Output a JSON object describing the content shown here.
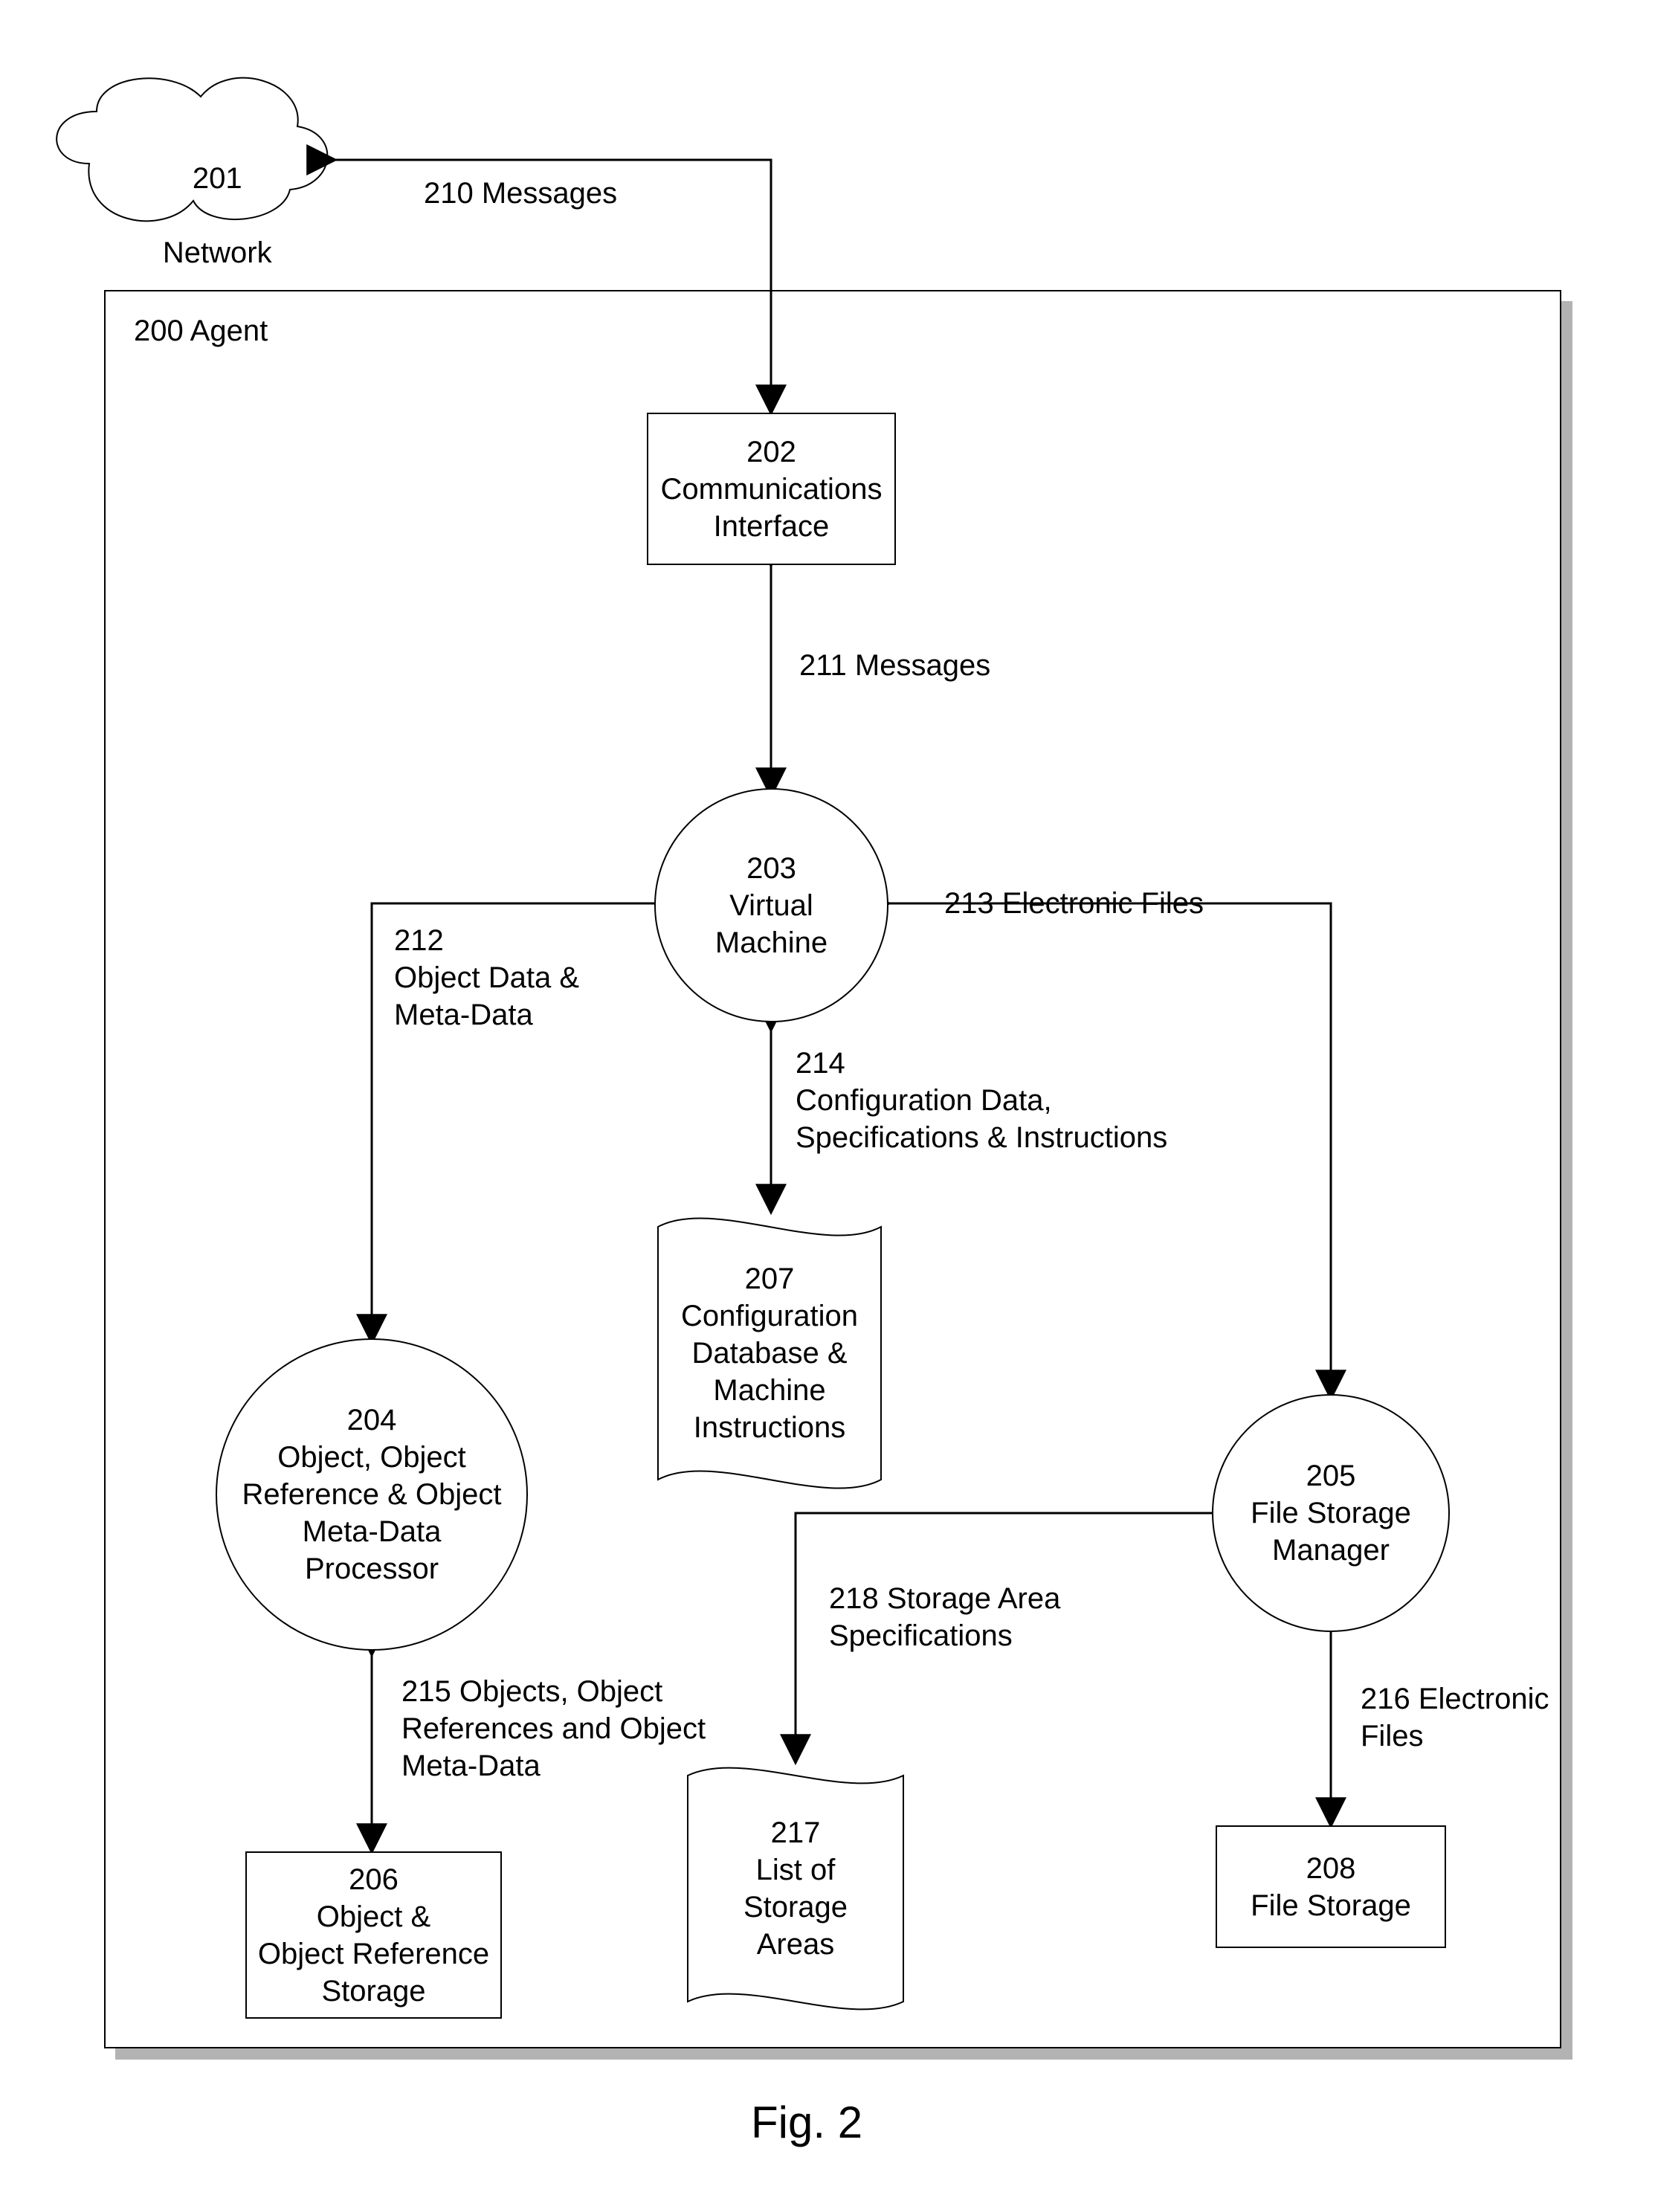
{
  "figure_caption": "Fig. 2",
  "agent_label": "200 Agent",
  "cloud": {
    "num": "201",
    "name": "Network"
  },
  "nodes": {
    "comm": {
      "num": "202",
      "name": "Communications\nInterface"
    },
    "vm": {
      "num": "203",
      "name": "Virtual\nMachine"
    },
    "objproc": {
      "num": "204",
      "name": "Object, Object\nReference & Object\nMeta-Data\nProcessor"
    },
    "fsm": {
      "num": "205",
      "name": "File Storage\nManager"
    },
    "objstor": {
      "num": "206",
      "name": "Object &\nObject Reference\nStorage"
    },
    "cfgdb": {
      "num": "207",
      "name": "Configuration\nDatabase &\nMachine\nInstructions"
    },
    "filestor": {
      "num": "208",
      "name": "File Storage"
    },
    "salist": {
      "num": "217",
      "name": "List of\nStorage\nAreas"
    }
  },
  "edges": {
    "e210": "210 Messages",
    "e211": "211 Messages",
    "e212": "212\nObject Data &\nMeta-Data",
    "e213": "213 Electronic Files",
    "e214": "214\nConfiguration Data,\nSpecifications & Instructions",
    "e215": "215 Objects, Object\nReferences and Object\nMeta-Data",
    "e216": "216 Electronic\nFiles",
    "e218": "218 Storage Area\nSpecifications"
  }
}
